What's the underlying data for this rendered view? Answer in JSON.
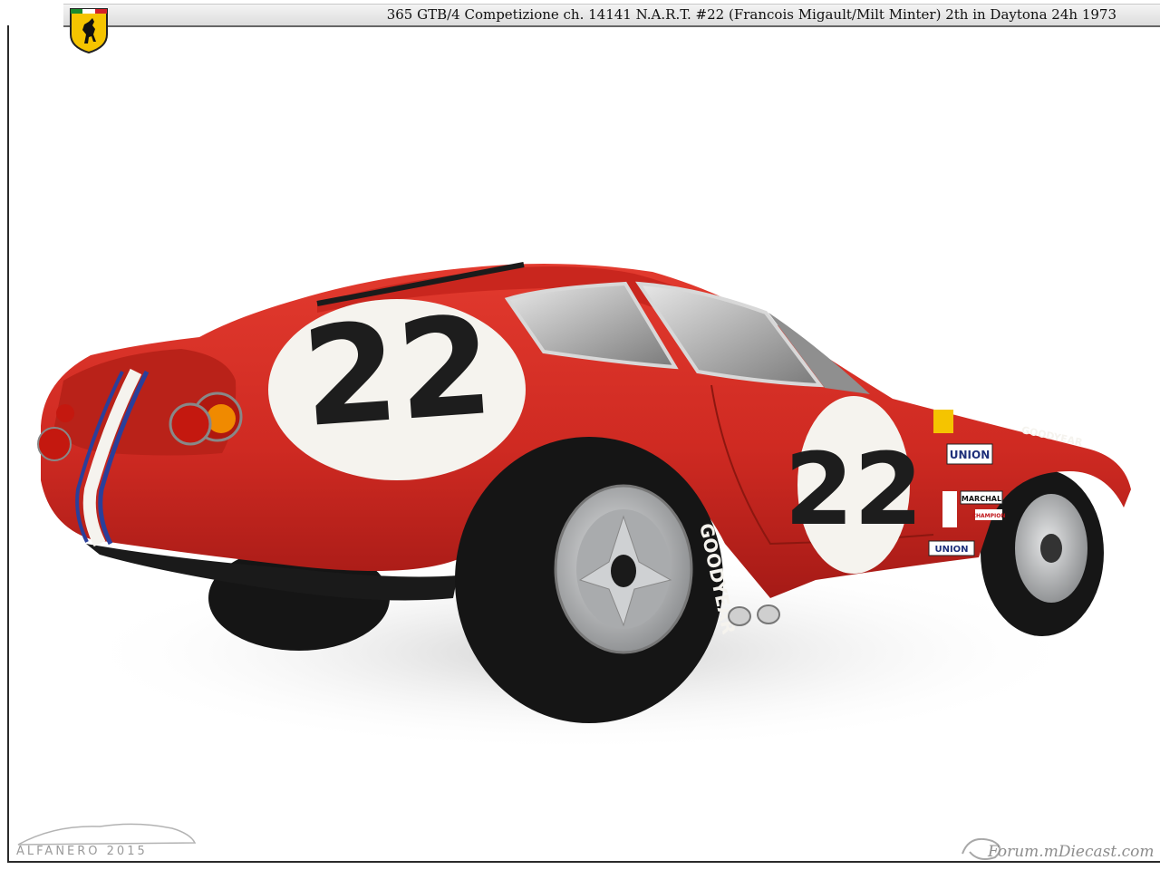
{
  "header": {
    "title": "365 GTB/4 Competizione  ch. 14141  N.A.R.T.  #22 (Francois Migault/Milt Minter)  2th in Daytona 24h 1973"
  },
  "car": {
    "number_rear": "22",
    "number_door": "22",
    "decals": {
      "union_1": "UNION",
      "union_2": "UNION",
      "goodyear": "GOODYEAR",
      "marchal": "MARCHAL",
      "champion": "CHAMPION",
      "tire_text": "GOODYEAR"
    }
  },
  "watermarks": {
    "left": "ALFANERO 2015",
    "right": "Forum.mDiecast.com"
  },
  "colors": {
    "body_red": "#d12a22",
    "roundel_white": "#f5f3ee",
    "stripe_blue": "#2a3f9a",
    "tire_black": "#151515",
    "wheel_silver": "#b4b6b8"
  }
}
